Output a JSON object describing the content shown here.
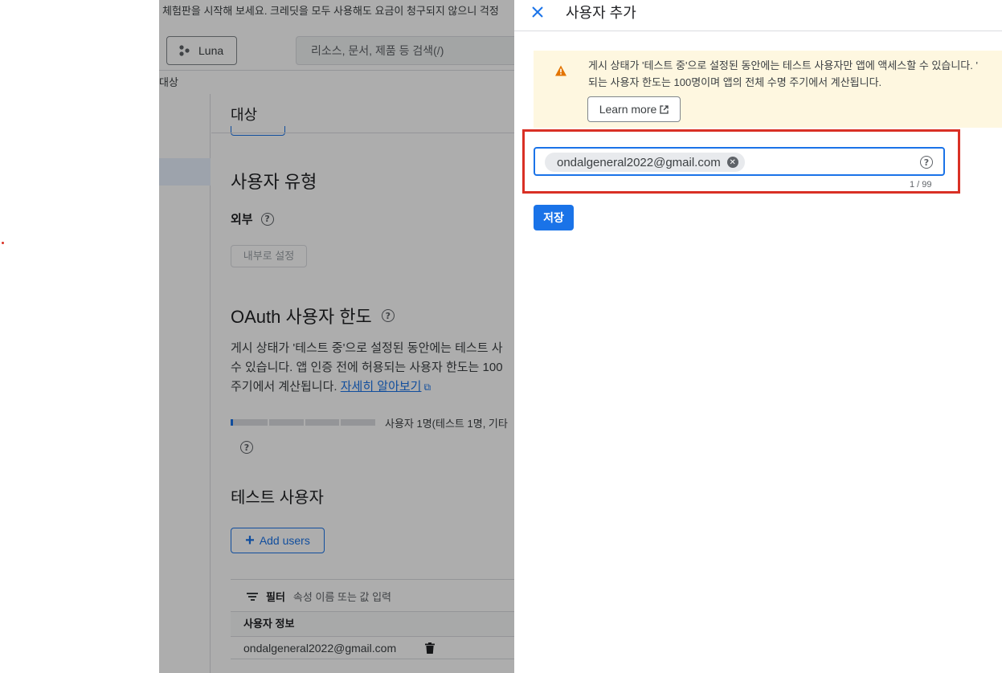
{
  "background": {
    "banner_text": "체험판을 시작해 보세요. 크레딧을 모두 사용해도 요금이 청구되지 않으니 걱정",
    "project_button_label": "Luna",
    "search_placeholder": "리소스, 문서, 제품 등 검색(/)",
    "breadcrumb": "대상",
    "content_title": "대상",
    "user_type_heading": "사용자 유형",
    "user_type_value": "외부",
    "set_internal_button": "내부로 설정",
    "oauth_heading": "OAuth 사용자 한도",
    "oauth_desc_line1": "게시 상태가 '테스트 중'으로 설정된 동안에는 테스트 사",
    "oauth_desc_line2": "수 있습니다. 앱 인증 전에 허용되는 사용자 한도는 100",
    "oauth_desc_line3_prefix": "주기에서 계산됩니다. ",
    "learn_more_link": "자세히 알아보기",
    "usage_label": "사용자 1명(테스트 1명, 기타",
    "usage_progress": 0.01,
    "test_users_heading": "테스트 사용자",
    "add_users_button": "Add users",
    "filter_label": "필터",
    "filter_placeholder": "속성 이름 또는 값 입력",
    "table_header": "사용자 정보",
    "table_rows": [
      {
        "email": "ondalgeneral2022@gmail.com"
      }
    ]
  },
  "panel": {
    "title": "사용자 추가",
    "warning_line1": "게시 상태가 '테스트 중'으로 설정된 동안에는 테스트 사용자만 앱에 액세스할 수 있습니다. '",
    "warning_line2": "되는 사용자 한도는 100명이며 앱의 전체 수명 주기에서 계산됩니다.",
    "learn_more_button": "Learn more",
    "chip_email": "ondalgeneral2022@gmail.com",
    "counter": "1 / 99",
    "save_button": "저장"
  },
  "colors": {
    "accent": "#1a73e8",
    "warning_bg": "#fef7e0",
    "warning_icon": "#e37400",
    "highlight": "#d93025"
  },
  "icons": {
    "close": "close-icon",
    "warning": "warning-icon",
    "help": "help-icon",
    "external_link": "external-link-icon",
    "chip_remove": "cancel-icon",
    "trash": "trash-icon",
    "filter": "filter-icon",
    "project": "project-icon"
  }
}
